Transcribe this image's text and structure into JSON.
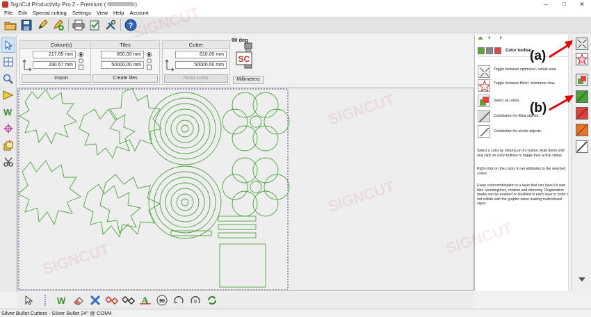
{
  "window": {
    "title": "SignCut Productivity Pro 2 - Premium (",
    "minimize": "–",
    "maximize": "□",
    "close": "✕"
  },
  "menu": [
    "File",
    "Edit",
    "Special cutting",
    "Settings",
    "View",
    "Help",
    "Account"
  ],
  "toolbar_icons": [
    "open-folder-icon",
    "save-icon",
    "pen-icon",
    "pen-add-icon",
    "printer-icon",
    "clipboard-check-icon",
    "tools-icon",
    "help-icon"
  ],
  "left_tools": [
    "select-arrow-icon",
    "grid-icon",
    "zoom-icon",
    "ruler-icon",
    "weed-w-icon",
    "crosshair-icon",
    "stack-icon",
    "scissors-icon"
  ],
  "colours_group": {
    "title": "Colour(s)",
    "width": "217.65 mm",
    "height": "290.57 mm",
    "button": "Import"
  },
  "tiles_group": {
    "title": "Tiles",
    "width": "800.00 mm",
    "height": "50000.00 mm",
    "button": "Create tiles"
  },
  "cutter_group": {
    "title": "Cutter",
    "width": "610.00 mm",
    "height": "50000.00 mm",
    "button": "Read cutter"
  },
  "rotation": {
    "label": "90 deg",
    "logo": "SC",
    "units_button": "Millimeters"
  },
  "help": {
    "header": "Color toolbar",
    "items": [
      "Toggle between optimized / whole area",
      "Toggle between filled / wireframe view.",
      "Select all colors.",
      "Colorbutton for filled objects.",
      "Colorbutton for stroke objects."
    ],
    "paragraphs": [
      "Select a color by clicking on it's button. Hold down shift and click on color-buttons to toggle their active status.",
      "Right-click on the colors to set attributes to the selected colors.",
      "Every colorcombination is a layer that can have it's own tiles, weedinglines, rotation and mirroring. Registration marks can be enabled or disabled in each layer in order to not collide with the graphic when making multicolored signs."
    ]
  },
  "annotations": {
    "a": "(a)",
    "b": "(b)"
  },
  "watermark": "SIGNCUT",
  "statusbar": "Silver Bullet Cutters - Silver Bullet 24\" @ COM4",
  "colors": {
    "accent": "#3c8a2e",
    "annotation_arrow": "#e00000",
    "shape_stroke": "#4aa33a"
  }
}
